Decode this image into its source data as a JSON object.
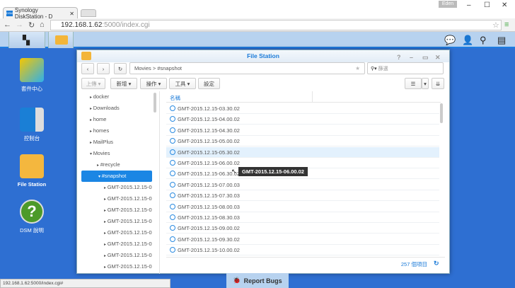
{
  "browser": {
    "tab_title": "Synology DiskStation - D",
    "url_host": "192.168.1.62",
    "url_rest": ":5000/index.cgi",
    "user": "Eden",
    "status_url": "192.168.1.62:5000/index.cgi#"
  },
  "desktop": {
    "icons": [
      {
        "label": "套件中心"
      },
      {
        "label": "控制台"
      },
      {
        "label": "File Station"
      },
      {
        "label": "DSM 說明"
      }
    ]
  },
  "window": {
    "title": "File Station",
    "path": [
      "Movies",
      "#snapshot"
    ],
    "path_sep": ">",
    "search_placeholder": "篩選",
    "toolbar": {
      "upload": "上傳 ▾",
      "create": "新增 ▾",
      "action": "操作 ▾",
      "tools": "工具 ▾",
      "settings": "設定"
    },
    "tree": [
      {
        "label": "docker",
        "level": 0,
        "state": "collapsed"
      },
      {
        "label": "Downloads",
        "level": 0,
        "state": "collapsed"
      },
      {
        "label": "home",
        "level": 0,
        "state": "collapsed"
      },
      {
        "label": "homes",
        "level": 0,
        "state": "collapsed"
      },
      {
        "label": "MailPlus",
        "level": 0,
        "state": "collapsed"
      },
      {
        "label": "Movies",
        "level": 0,
        "state": "expanded"
      },
      {
        "label": "#recycle",
        "level": 1,
        "state": "collapsed"
      },
      {
        "label": "#snapshot",
        "level": 1,
        "state": "expanded",
        "selected": true
      },
      {
        "label": "GMT-2015.12.15-0",
        "level": 2
      },
      {
        "label": "GMT-2015.12.15-0",
        "level": 2
      },
      {
        "label": "GMT-2015.12.15-0",
        "level": 2
      },
      {
        "label": "GMT-2015.12.15-0",
        "level": 2
      },
      {
        "label": "GMT-2015.12.15-0",
        "level": 2
      },
      {
        "label": "GMT-2015.12.15-0",
        "level": 2
      },
      {
        "label": "GMT-2015.12.15-0",
        "level": 2
      },
      {
        "label": "GMT-2015.12.15-0",
        "level": 2
      }
    ],
    "column_name": "名稱",
    "files": [
      "GMT-2015.12.15-03.30.02",
      "GMT-2015.12.15-04.00.02",
      "GMT-2015.12.15-04.30.02",
      "GMT-2015.12.15-05.00.02",
      "GMT-2015.12.15-05.30.02",
      "GMT-2015.12.15-06.00.02",
      "GMT-2015.12.15-06.30.02",
      "GMT-2015.12.15-07.00.03",
      "GMT-2015.12.15-07.30.03",
      "GMT-2015.12.15-08.00.03",
      "GMT-2015.12.15-08.30.03",
      "GMT-2015.12.15-09.00.02",
      "GMT-2015.12.15-09.30.02",
      "GMT-2015.12.15-10.00.02"
    ],
    "hover_index": 4,
    "tooltip": "GMT-2015.12.15-06.00.02",
    "item_count": "257 個項目"
  },
  "report_bugs": "Report Bugs"
}
